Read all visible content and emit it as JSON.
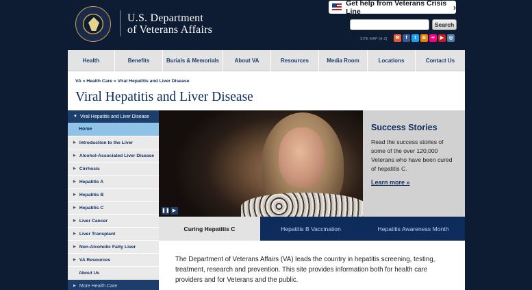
{
  "header": {
    "dept_line1": "U.S. Department",
    "dept_line2": "of Veterans Affairs",
    "crisis_label": "Get help from Veterans Crisis Line",
    "crisis_arrow": "›",
    "search_placeholder": "",
    "search_button": "Search",
    "sitemap": "SITE MAP  [A-Z]",
    "social_icons": [
      "email-icon",
      "facebook-icon",
      "twitter-icon",
      "blog-icon",
      "flickr-icon",
      "youtube-icon",
      "instagram-icon"
    ]
  },
  "nav": {
    "items": [
      "Health",
      "Benefits",
      "Burials & Memorials",
      "About VA",
      "Resources",
      "Media Room",
      "Locations",
      "Contact Us"
    ]
  },
  "breadcrumb": "VA » Health Care » Viral Hepatitis and Liver Disease",
  "page_title": "Viral Hepatitis and Liver Disease",
  "sidebar": {
    "header": "Viral Hepatitis and Liver Disease",
    "home": "Home",
    "items": [
      "Introduction to the Liver",
      "Alcohol-Associated Liver Disease",
      "Cirrhosis",
      "Hepatitis A",
      "Hepatitis B",
      "Hepatitis C",
      "Liver Cancer",
      "Liver Transplant",
      "Non-Alcoholic Fatty Liver",
      "VA Resources",
      "About Us"
    ],
    "more": "More Health Care"
  },
  "hero": {
    "controls": [
      "pause-icon",
      "play-icon"
    ]
  },
  "story": {
    "title": "Success Stories",
    "body": "Read the success stories of some of the over 120,000 Veterans who have been cured of hepatitis C.",
    "link": "Learn more »"
  },
  "tabs": [
    "Curing Hepatitis C",
    "Hepatitis B Vaccination",
    "Hepatitis Awareness Month"
  ],
  "intro": "The Department of Veterans Affairs (VA) leads the country in hepatitis screening, testing, treatment, research and prevention. This site provides information both for health care providers and for Veterans and the public.",
  "colors": {
    "navy": "#0d1b33",
    "brand_blue": "#0d2b5b",
    "sidebar_active": "#8fc3e8",
    "nav_bg": "#e3e3e3"
  }
}
